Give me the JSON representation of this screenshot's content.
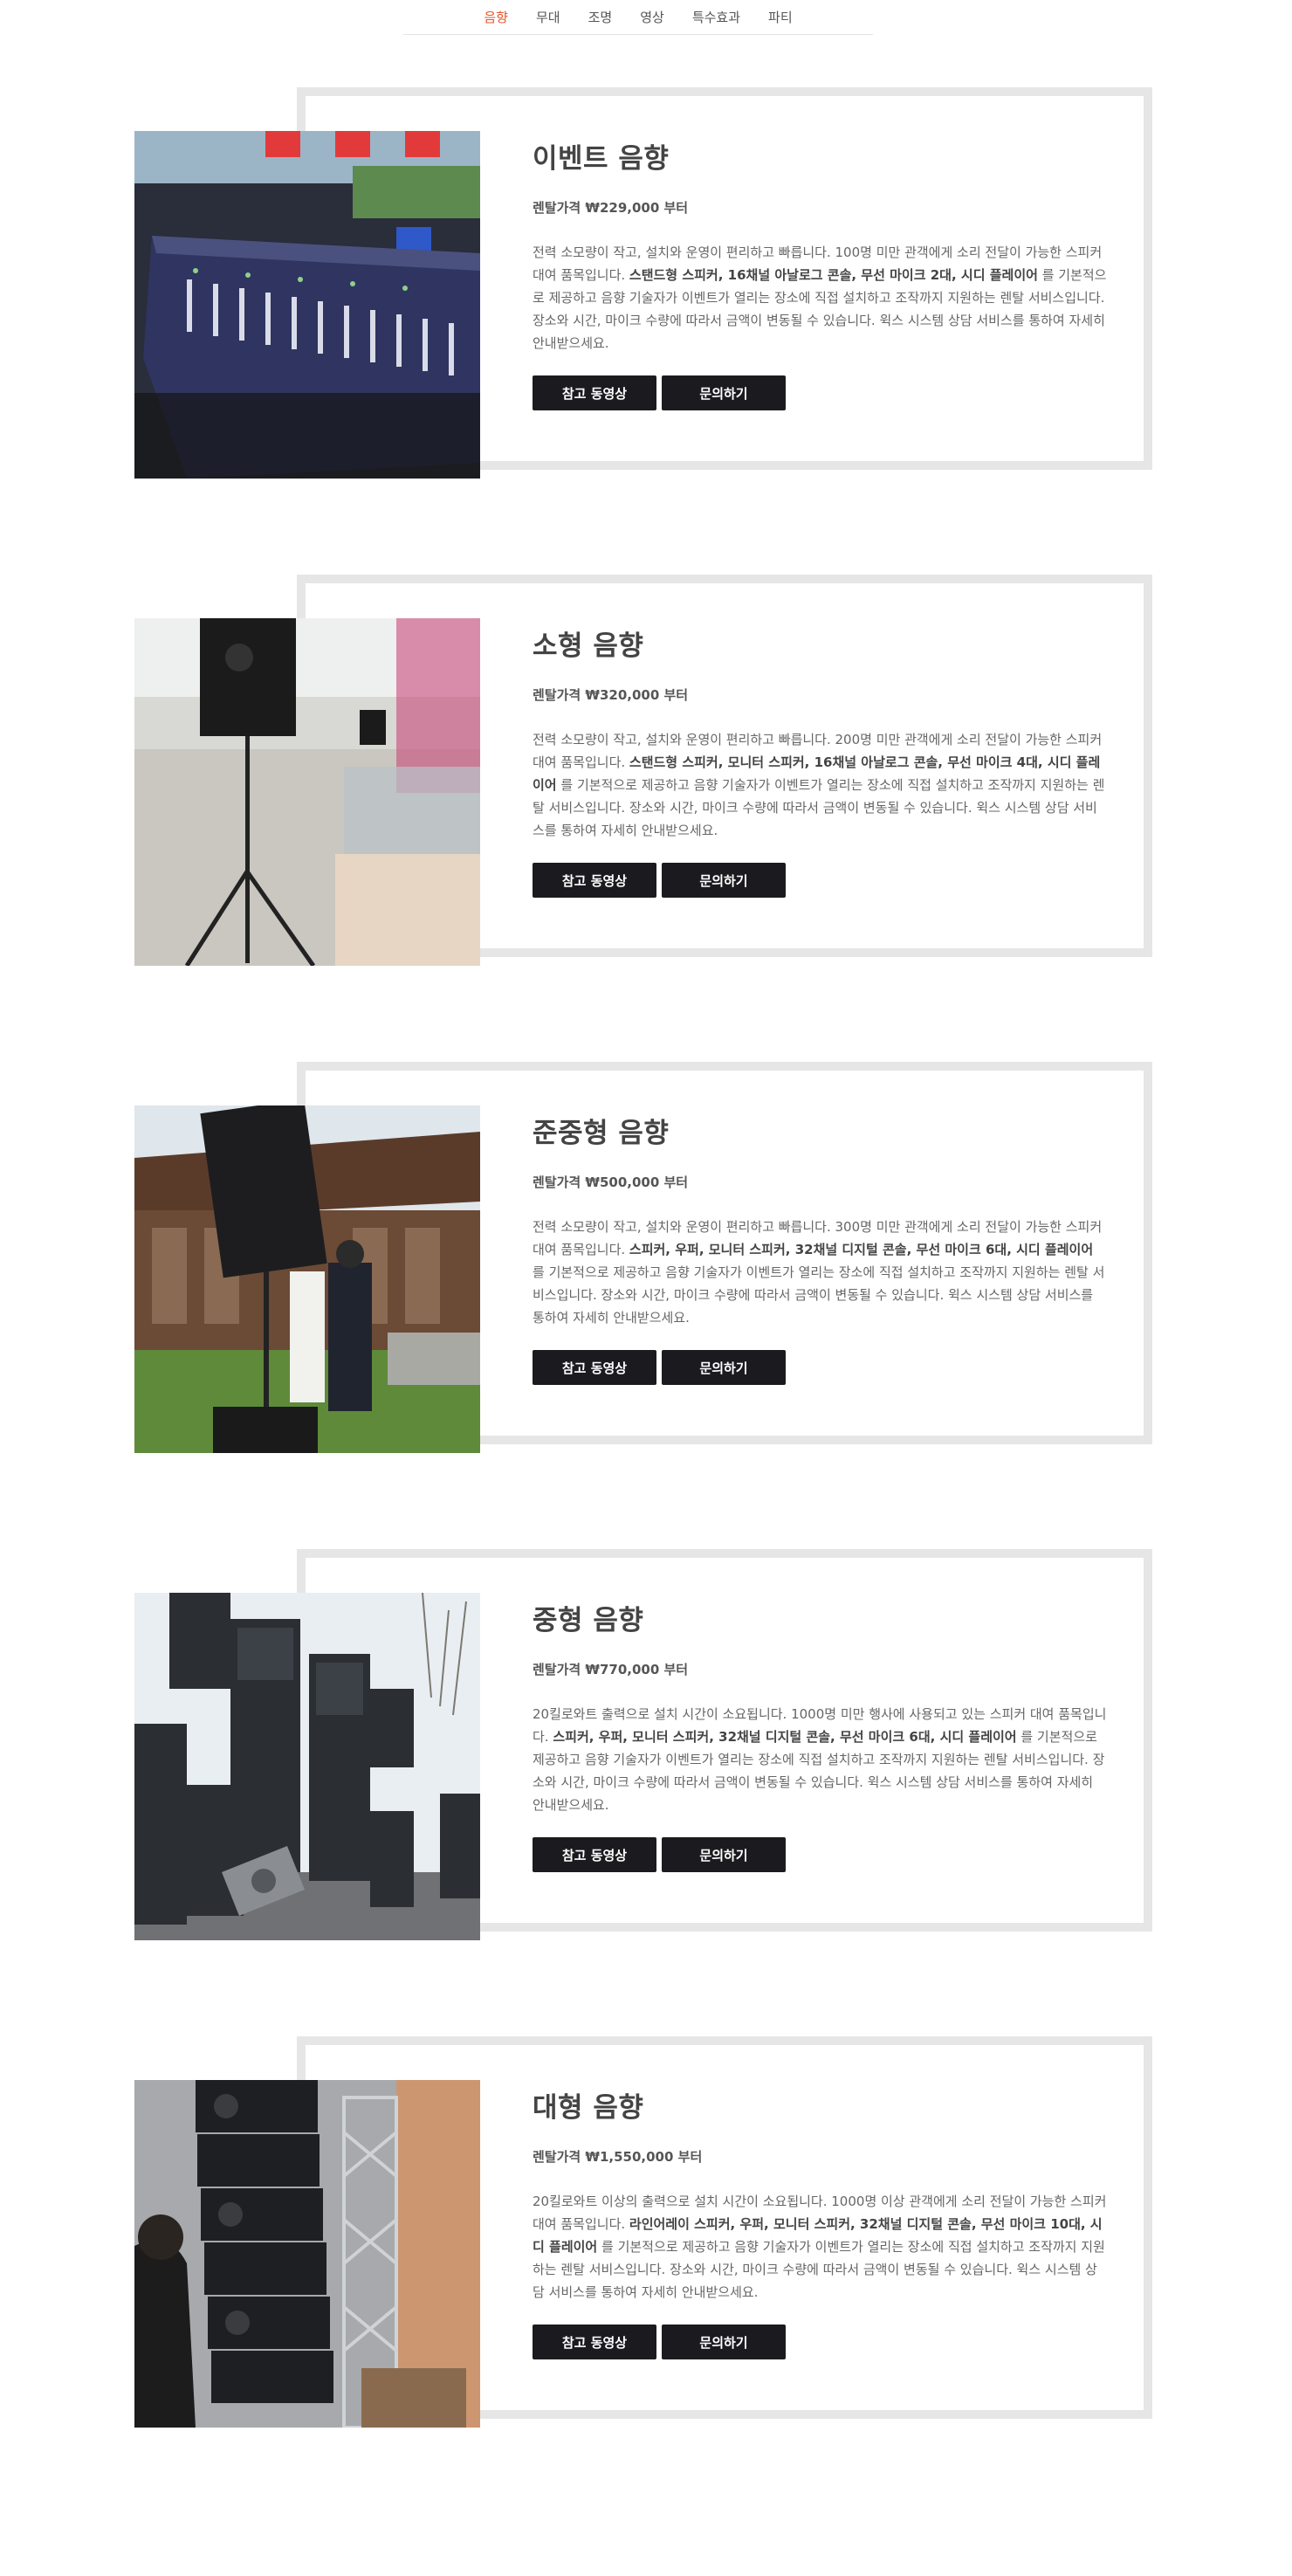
{
  "nav": {
    "items": [
      {
        "label": "음향",
        "active": true
      },
      {
        "label": "무대"
      },
      {
        "label": "조명"
      },
      {
        "label": "영상"
      },
      {
        "label": "특수효과"
      },
      {
        "label": "파티"
      }
    ],
    "active_color": "#e8552b"
  },
  "buttons": {
    "video": "참고 동영상",
    "inquiry": "문의하기"
  },
  "products": [
    {
      "title": "이벤트 음향",
      "price": "렌탈가격 ₩229,000 부터",
      "desc_pre": "전력 소모량이 작고, 설치와 운영이 편리하고 빠릅니다. 100명 미만 관객에게 소리 전달이 가능한 스피커 대여 품목입니다. ",
      "desc_bold": "스탠드형 스피커, 16채널 아날로그 콘솔, 무선 마이크 2대, 시디 플레이어",
      "desc_post": " 를 기본적으로 제공하고 음향 기술자가 이벤트가 열리는 장소에 직접 설치하고 조작까지 지원하는 렌탈 서비스입니다. 장소와 시간, 마이크 수량에 따라서 금액이 변동될 수 있습니다. 윅스 시스템 상담 서비스를 통하여 자세히 안내받으세요.",
      "image": "mixing-console-photo"
    },
    {
      "title": "소형 음향",
      "price": "렌탈가격 ₩320,000 부터",
      "desc_pre": "전력 소모량이 작고, 설치와 운영이 편리하고 빠릅니다. 200명 미만 관객에게 소리 전달이 가능한 스피커 대여 품목입니다. ",
      "desc_bold": "스탠드형 스피커, 모니터 스피커, 16채널 아날로그 콘솔, 무선 마이크 4대, 시디 플레이어",
      "desc_post": " 를 기본적으로 제공하고 음향 기술자가 이벤트가 열리는 장소에 직접 설치하고 조작까지 지원하는 렌탈 서비스입니다. 장소와 시간, 마이크 수량에 따라서 금액이 변동될 수 있습니다. 윅스 시스템 상담 서비스를 통하여 자세히 안내받으세요.",
      "image": "speaker-on-stand-mall-photo"
    },
    {
      "title": "준중형 음향",
      "price": "렌탈가격 ₩500,000 부터",
      "desc_pre": "전력 소모량이 작고, 설치와 운영이 편리하고 빠릅니다. 300명 미만 관객에게 소리 전달이 가능한 스피커 대여 품목입니다. ",
      "desc_bold": "스피커, 우퍼, 모니터 스피커, 32채널 디지털 콘솔, 무선 마이크 6대, 시디 플레이어",
      "desc_post": " 를 기본적으로 제공하고 음향 기술자가 이벤트가 열리는 장소에 직접 설치하고 조작까지 지원하는 렌탈 서비스입니다. 장소와 시간, 마이크 수량에 따라서 금액이 변동될 수 있습니다. 윅스 시스템 상담 서비스를 통하여 자세히 안내받으세요.",
      "image": "speaker-at-hanok-photo"
    },
    {
      "title": "중형 음향",
      "price": "렌탈가격 ₩770,000 부터",
      "desc_pre": "20킬로와트 출력으로 설치 시간이 소요됩니다. 1000명 미만 행사에 사용되고 있는 스피커 대여 품목입니다. ",
      "desc_bold": "스피커, 우퍼, 모니터 스피커, 32채널 디지털 콘솔, 무선 마이크 6대, 시디 플레이어",
      "desc_post": " 를 기본적으로 제공하고 음향 기술자가 이벤트가 열리는 장소에 직접 설치하고 조작까지 지원하는 렌탈 서비스입니다. 장소와 시간, 마이크 수량에 따라서 금액이 변동될 수 있습니다. 윅스 시스템 상담 서비스를 통하여 자세히 안내받으세요.",
      "image": "speaker-stacks-outdoor-photo"
    },
    {
      "title": "대형 음향",
      "price": "렌탈가격 ₩1,550,000 부터",
      "desc_pre": "20킬로와트 이상의 출력으로 설치 시간이 소요됩니다. 1000명 이상 관객에게 소리 전달이 가능한 스피커 대여 품목입니다. ",
      "desc_bold": "라인어레이 스피커, 우퍼, 모니터 스피커, 32채널 디지털 콘솔, 무선 마이크 10대, 시디 플레이어",
      "desc_post": " 를 기본적으로 제공하고 음향 기술자가 이벤트가 열리는 장소에 직접 설치하고 조작까지 지원하는 렌탈 서비스입니다. 장소와 시간, 마이크 수량에 따라서 금액이 변동될 수 있습니다. 윅스 시스템 상담 서비스를 통하여 자세히 안내받으세요.",
      "image": "line-array-truss-photo"
    }
  ]
}
